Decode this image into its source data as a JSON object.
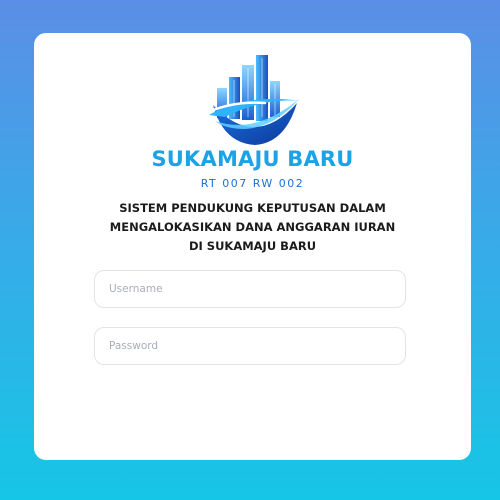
{
  "brand": {
    "title": "SUKAMAJU BARU",
    "subtitle": "RT 007 RW 002"
  },
  "heading": {
    "line1": "SISTEM PENDUKUNG KEPUTUSAN DALAM",
    "line2": "MENGALOKASIKAN DANA ANGGARAN IURAN",
    "line3": "DI SUKAMAJU BARU"
  },
  "form": {
    "username_placeholder": "Username",
    "username_value": "",
    "password_placeholder": "Password",
    "password_value": ""
  },
  "colors": {
    "bg_top": "#5b8ee6",
    "bg_bottom": "#16c6e6",
    "brand": "#1aa3e6",
    "subtitle": "#1f6fd4"
  },
  "icons": {
    "logo": "city-buildings-globe-logo"
  }
}
